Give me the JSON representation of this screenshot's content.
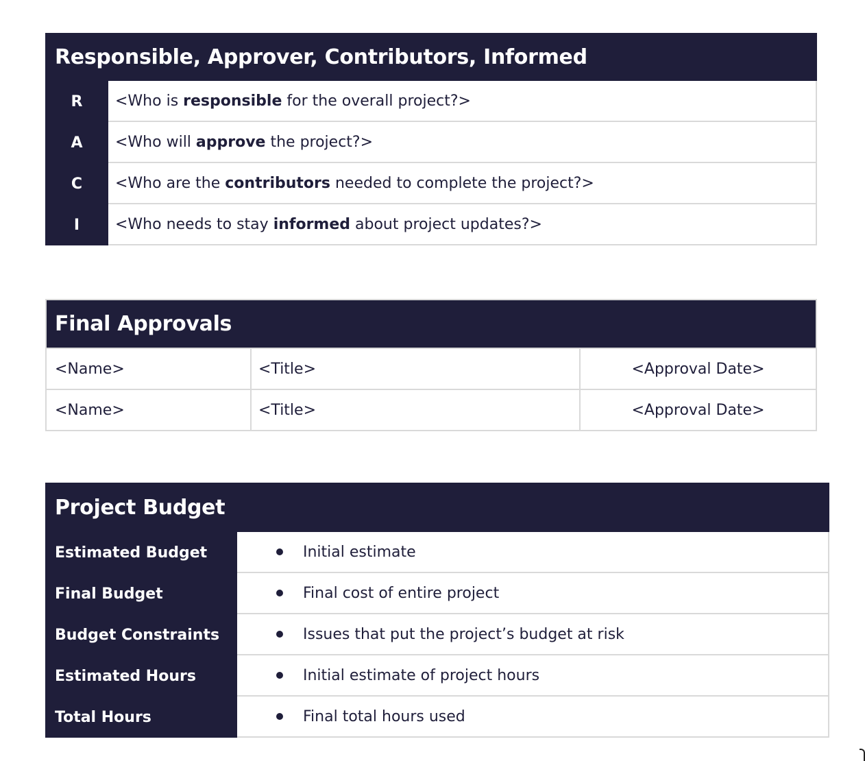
{
  "raci": {
    "title": "Responsible, Approver, Contributors, Informed",
    "rows": [
      {
        "letter": "R",
        "before": "<Who is ",
        "bold": "responsible",
        "after": " for the overall project?>"
      },
      {
        "letter": "A",
        "before": "<Who will ",
        "bold": "approve",
        "after": " the project?>"
      },
      {
        "letter": "C",
        "before": "<Who are the ",
        "bold": "contributors",
        "after": " needed to complete the project?>"
      },
      {
        "letter": "I",
        "before": "<Who needs to stay ",
        "bold": "informed",
        "after": " about project updates?>"
      }
    ]
  },
  "approvals": {
    "title": "Final Approvals",
    "rows": [
      {
        "name": "<Name>",
        "title": "<Title>",
        "date": "<Approval Date>"
      },
      {
        "name": "<Name>",
        "title": "<Title>",
        "date": "<Approval Date>"
      }
    ]
  },
  "budget": {
    "title": "Project Budget",
    "rows": [
      {
        "label": "Estimated Budget",
        "value": "Initial estimate"
      },
      {
        "label": "Final Budget",
        "value": "Final cost of entire project"
      },
      {
        "label": "Budget Constraints",
        "value": "Issues that put the project’s budget at risk"
      },
      {
        "label": "Estimated Hours",
        "value": "Initial estimate of project hours"
      },
      {
        "label": "Total Hours",
        "value": "Final total hours used"
      }
    ]
  },
  "colors": {
    "navy": "#1f1e3a",
    "border": "#d9d9d9"
  }
}
